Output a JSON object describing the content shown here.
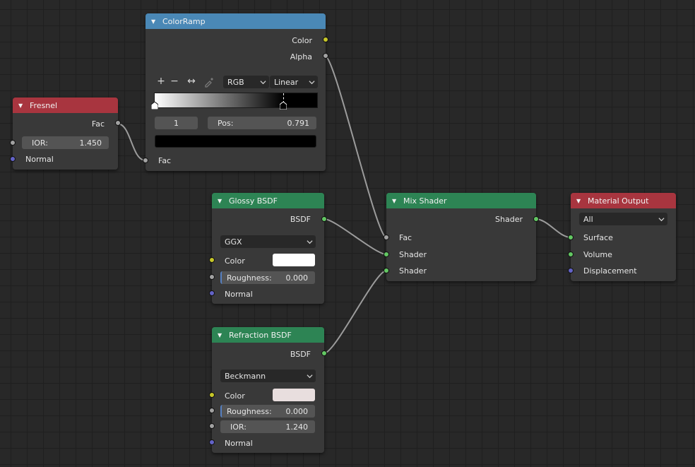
{
  "nodes": {
    "fresnel": {
      "title": "Fresnel",
      "outputs": {
        "fac": "Fac"
      },
      "ior": {
        "label": "IOR:",
        "value": "1.450"
      },
      "inputs": {
        "normal": "Normal"
      }
    },
    "colorramp": {
      "title": "ColorRamp",
      "outputs": {
        "color": "Color",
        "alpha": "Alpha"
      },
      "toolbar": {
        "add_icon": "plus-icon",
        "remove_icon": "minus-icon",
        "flip_icon": "flip-arrows-icon",
        "eyedropper_icon": "eyedropper-icon",
        "color_mode": "RGB",
        "interpolation": "Linear"
      },
      "ramp": {
        "stops": [
          {
            "position": 0.0,
            "color": "#ffffff"
          },
          {
            "position": 0.791,
            "color": "#000000"
          }
        ]
      },
      "active_index": "1",
      "pos_label": "Pos:",
      "pos_value": "0.791",
      "active_color": "#000000",
      "inputs": {
        "fac": "Fac"
      }
    },
    "glossy": {
      "title": "Glossy BSDF",
      "outputs": {
        "bsdf": "BSDF"
      },
      "distribution": "GGX",
      "color_label": "Color",
      "color_value": "#ffffff",
      "roughness": {
        "label": "Roughness:",
        "value": "0.000"
      },
      "normal_label": "Normal"
    },
    "refraction": {
      "title": "Refraction BSDF",
      "outputs": {
        "bsdf": "BSDF"
      },
      "distribution": "Beckmann",
      "color_label": "Color",
      "color_value": "#e8dede",
      "roughness": {
        "label": "Roughness:",
        "value": "0.000"
      },
      "ior": {
        "label": "IOR:",
        "value": "1.240"
      },
      "normal_label": "Normal"
    },
    "mix": {
      "title": "Mix Shader",
      "outputs": {
        "shader": "Shader"
      },
      "inputs": {
        "fac": "Fac",
        "shader1": "Shader",
        "shader2": "Shader"
      }
    },
    "output": {
      "title": "Material Output",
      "target": "All",
      "inputs": {
        "surface": "Surface",
        "volume": "Volume",
        "displacement": "Displacement"
      }
    }
  },
  "colors": {
    "header_converter": "#4a88b6",
    "header_input": "#a8353f",
    "header_shader": "#2d8454",
    "socket_float": "#a2a2a2",
    "socket_color": "#c7c729",
    "socket_shader": "#63c763",
    "socket_vector": "#6363c7",
    "link": "#a0a0a0"
  }
}
